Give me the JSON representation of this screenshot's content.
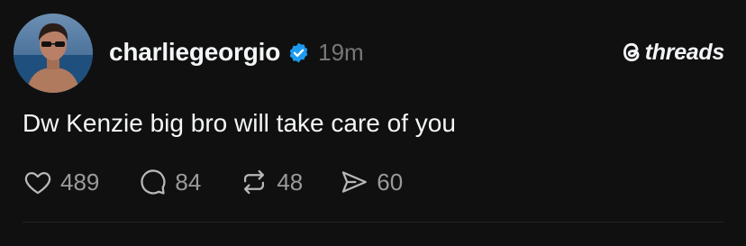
{
  "post": {
    "username": "charliegeorgio",
    "timestamp": "19m",
    "verified": true,
    "text": "Dw Kenzie big bro will take care of you",
    "avatar_icon": "profile-photo"
  },
  "brand": {
    "logo_icon": "threads-logo",
    "name": "threads"
  },
  "actions": {
    "like": {
      "icon": "heart-icon",
      "count": "489"
    },
    "reply": {
      "icon": "comment-bubble-icon",
      "count": "84"
    },
    "repost": {
      "icon": "repost-icon",
      "count": "48"
    },
    "share": {
      "icon": "send-icon",
      "count": "60"
    }
  },
  "colors": {
    "background": "#101010",
    "text": "#f3f5f7",
    "muted": "#777777",
    "verified": "#1d9bf0"
  }
}
